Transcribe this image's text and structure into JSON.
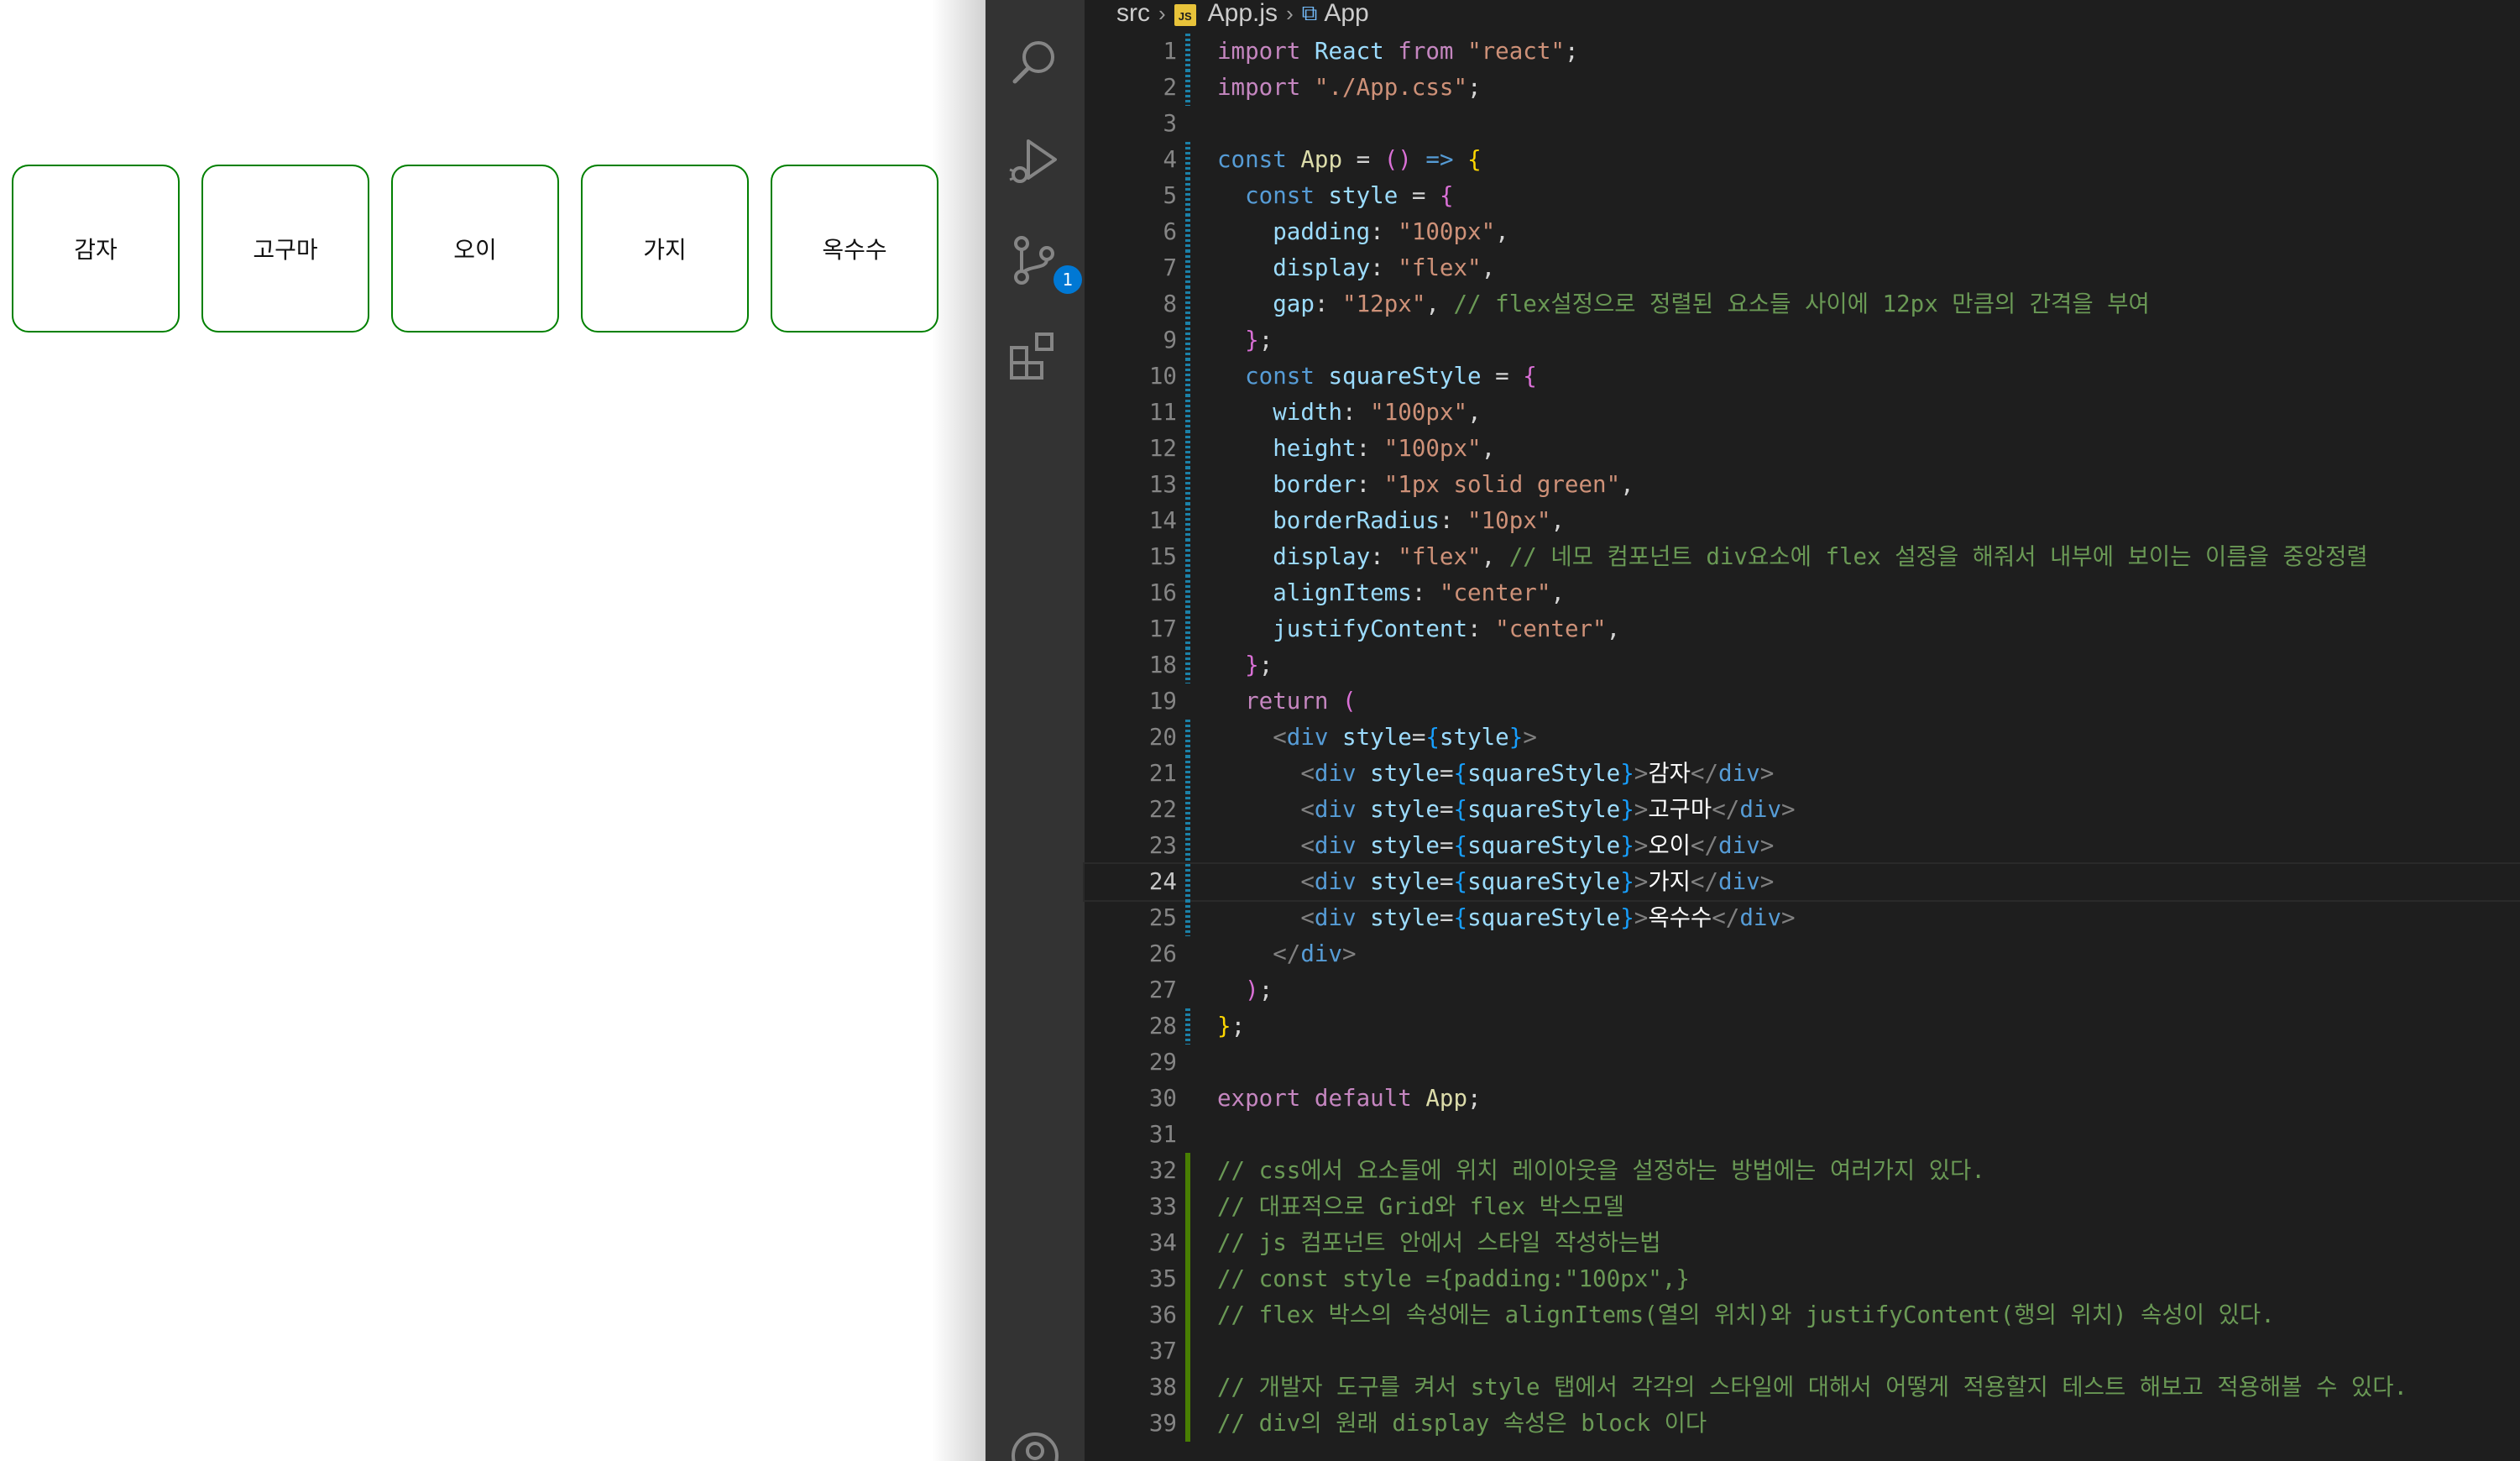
{
  "preview": {
    "items": [
      "감자",
      "고구마",
      "오이",
      "가지",
      "옥수수"
    ]
  },
  "activity_bar": {
    "icons": [
      "search-icon",
      "run-debug-icon",
      "source-control-icon",
      "extensions-icon",
      "account-icon"
    ],
    "scm_badge": "1"
  },
  "breadcrumb": {
    "folder": "src",
    "file": "App.js",
    "file_badge": "JS",
    "symbol": "App"
  },
  "editor": {
    "current_line": 24,
    "lines": [
      {
        "n": "1",
        "gutter": "mod",
        "tokens": [
          [
            "kw",
            "import"
          ],
          [
            "plain",
            " "
          ],
          [
            "var",
            "React"
          ],
          [
            "plain",
            " "
          ],
          [
            "kw",
            "from"
          ],
          [
            "plain",
            " "
          ],
          [
            "str",
            "\"react\""
          ],
          [
            "plain",
            ";"
          ]
        ]
      },
      {
        "n": "2",
        "gutter": "mod",
        "tokens": [
          [
            "kw",
            "import"
          ],
          [
            "plain",
            " "
          ],
          [
            "str",
            "\"./App.css\""
          ],
          [
            "plain",
            ";"
          ]
        ]
      },
      {
        "n": "3",
        "gutter": "",
        "tokens": []
      },
      {
        "n": "4",
        "gutter": "mod",
        "tokens": [
          [
            "dec",
            "const"
          ],
          [
            "plain",
            " "
          ],
          [
            "fn",
            "App"
          ],
          [
            "plain",
            " = "
          ],
          [
            "p2",
            "()"
          ],
          [
            "plain",
            " "
          ],
          [
            "dec",
            "=>"
          ],
          [
            "plain",
            " "
          ],
          [
            "p1",
            "{"
          ]
        ]
      },
      {
        "n": "5",
        "gutter": "mod",
        "tokens": [
          [
            "plain",
            "  "
          ],
          [
            "dec",
            "const"
          ],
          [
            "plain",
            " "
          ],
          [
            "var",
            "style"
          ],
          [
            "plain",
            " = "
          ],
          [
            "p2",
            "{"
          ]
        ]
      },
      {
        "n": "6",
        "gutter": "mod",
        "tokens": [
          [
            "plain",
            "    "
          ],
          [
            "var",
            "padding"
          ],
          [
            "plain",
            ": "
          ],
          [
            "str",
            "\"100px\""
          ],
          [
            "plain",
            ","
          ]
        ]
      },
      {
        "n": "7",
        "gutter": "mod",
        "tokens": [
          [
            "plain",
            "    "
          ],
          [
            "var",
            "display"
          ],
          [
            "plain",
            ": "
          ],
          [
            "str",
            "\"flex\""
          ],
          [
            "plain",
            ","
          ]
        ]
      },
      {
        "n": "8",
        "gutter": "mod",
        "tokens": [
          [
            "plain",
            "    "
          ],
          [
            "var",
            "gap"
          ],
          [
            "plain",
            ": "
          ],
          [
            "str",
            "\"12px\""
          ],
          [
            "plain",
            ", "
          ],
          [
            "com",
            "// flex설정으로 정렬된 요소들 사이에 12px 만큼의 간격을 부여"
          ]
        ]
      },
      {
        "n": "9",
        "gutter": "mod",
        "tokens": [
          [
            "plain",
            "  "
          ],
          [
            "p2",
            "}"
          ],
          [
            "plain",
            ";"
          ]
        ]
      },
      {
        "n": "10",
        "gutter": "mod",
        "tokens": [
          [
            "plain",
            "  "
          ],
          [
            "dec",
            "const"
          ],
          [
            "plain",
            " "
          ],
          [
            "var",
            "squareStyle"
          ],
          [
            "plain",
            " = "
          ],
          [
            "p2",
            "{"
          ]
        ]
      },
      {
        "n": "11",
        "gutter": "mod",
        "tokens": [
          [
            "plain",
            "    "
          ],
          [
            "var",
            "width"
          ],
          [
            "plain",
            ": "
          ],
          [
            "str",
            "\"100px\""
          ],
          [
            "plain",
            ","
          ]
        ]
      },
      {
        "n": "12",
        "gutter": "mod",
        "tokens": [
          [
            "plain",
            "    "
          ],
          [
            "var",
            "height"
          ],
          [
            "plain",
            ": "
          ],
          [
            "str",
            "\"100px\""
          ],
          [
            "plain",
            ","
          ]
        ]
      },
      {
        "n": "13",
        "gutter": "mod",
        "tokens": [
          [
            "plain",
            "    "
          ],
          [
            "var",
            "border"
          ],
          [
            "plain",
            ": "
          ],
          [
            "str",
            "\"1px solid green\""
          ],
          [
            "plain",
            ","
          ]
        ]
      },
      {
        "n": "14",
        "gutter": "mod",
        "tokens": [
          [
            "plain",
            "    "
          ],
          [
            "var",
            "borderRadius"
          ],
          [
            "plain",
            ": "
          ],
          [
            "str",
            "\"10px\""
          ],
          [
            "plain",
            ","
          ]
        ]
      },
      {
        "n": "15",
        "gutter": "mod",
        "tokens": [
          [
            "plain",
            "    "
          ],
          [
            "var",
            "display"
          ],
          [
            "plain",
            ": "
          ],
          [
            "str",
            "\"flex\""
          ],
          [
            "plain",
            ", "
          ],
          [
            "com",
            "// 네모 컴포넌트 div요소에 flex 설정을 해줘서 내부에 보이는 이름을 중앙정렬"
          ]
        ]
      },
      {
        "n": "16",
        "gutter": "mod",
        "tokens": [
          [
            "plain",
            "    "
          ],
          [
            "var",
            "alignItems"
          ],
          [
            "plain",
            ": "
          ],
          [
            "str",
            "\"center\""
          ],
          [
            "plain",
            ","
          ]
        ]
      },
      {
        "n": "17",
        "gutter": "mod",
        "tokens": [
          [
            "plain",
            "    "
          ],
          [
            "var",
            "justifyContent"
          ],
          [
            "plain",
            ": "
          ],
          [
            "str",
            "\"center\""
          ],
          [
            "plain",
            ","
          ]
        ]
      },
      {
        "n": "18",
        "gutter": "mod",
        "tokens": [
          [
            "plain",
            "  "
          ],
          [
            "p2",
            "}"
          ],
          [
            "plain",
            ";"
          ]
        ]
      },
      {
        "n": "19",
        "gutter": "",
        "tokens": [
          [
            "plain",
            "  "
          ],
          [
            "kw",
            "return"
          ],
          [
            "plain",
            " "
          ],
          [
            "p2",
            "("
          ]
        ]
      },
      {
        "n": "20",
        "gutter": "mod",
        "tokens": [
          [
            "plain",
            "    "
          ],
          [
            "ang",
            "<"
          ],
          [
            "tag",
            "div"
          ],
          [
            "plain",
            " "
          ],
          [
            "var",
            "style"
          ],
          [
            "plain",
            "="
          ],
          [
            "p3",
            "{"
          ],
          [
            "var",
            "style"
          ],
          [
            "p3",
            "}"
          ],
          [
            "ang",
            ">"
          ]
        ]
      },
      {
        "n": "21",
        "gutter": "mod",
        "tokens": [
          [
            "plain",
            "      "
          ],
          [
            "ang",
            "<"
          ],
          [
            "tag",
            "div"
          ],
          [
            "plain",
            " "
          ],
          [
            "var",
            "style"
          ],
          [
            "plain",
            "="
          ],
          [
            "p3",
            "{"
          ],
          [
            "var",
            "squareStyle"
          ],
          [
            "p3",
            "}"
          ],
          [
            "ang",
            ">"
          ],
          [
            "txt",
            "감자"
          ],
          [
            "ang",
            "</"
          ],
          [
            "tag",
            "div"
          ],
          [
            "ang",
            ">"
          ]
        ]
      },
      {
        "n": "22",
        "gutter": "mod",
        "tokens": [
          [
            "plain",
            "      "
          ],
          [
            "ang",
            "<"
          ],
          [
            "tag",
            "div"
          ],
          [
            "plain",
            " "
          ],
          [
            "var",
            "style"
          ],
          [
            "plain",
            "="
          ],
          [
            "p3",
            "{"
          ],
          [
            "var",
            "squareStyle"
          ],
          [
            "p3",
            "}"
          ],
          [
            "ang",
            ">"
          ],
          [
            "txt",
            "고구마"
          ],
          [
            "ang",
            "</"
          ],
          [
            "tag",
            "div"
          ],
          [
            "ang",
            ">"
          ]
        ]
      },
      {
        "n": "23",
        "gutter": "mod",
        "tokens": [
          [
            "plain",
            "      "
          ],
          [
            "ang",
            "<"
          ],
          [
            "tag",
            "div"
          ],
          [
            "plain",
            " "
          ],
          [
            "var",
            "style"
          ],
          [
            "plain",
            "="
          ],
          [
            "p3",
            "{"
          ],
          [
            "var",
            "squareStyle"
          ],
          [
            "p3",
            "}"
          ],
          [
            "ang",
            ">"
          ],
          [
            "txt",
            "오이"
          ],
          [
            "ang",
            "</"
          ],
          [
            "tag",
            "div"
          ],
          [
            "ang",
            ">"
          ]
        ]
      },
      {
        "n": "24",
        "gutter": "mod",
        "tokens": [
          [
            "plain",
            "      "
          ],
          [
            "ang",
            "<"
          ],
          [
            "tag",
            "div"
          ],
          [
            "plain",
            " "
          ],
          [
            "var",
            "style"
          ],
          [
            "plain",
            "="
          ],
          [
            "p3",
            "{"
          ],
          [
            "var",
            "squareStyle"
          ],
          [
            "p3",
            "}"
          ],
          [
            "ang",
            ">"
          ],
          [
            "txt",
            "가지"
          ],
          [
            "ang",
            "</"
          ],
          [
            "tag",
            "div"
          ],
          [
            "ang",
            ">"
          ]
        ]
      },
      {
        "n": "25",
        "gutter": "mod",
        "tokens": [
          [
            "plain",
            "      "
          ],
          [
            "ang",
            "<"
          ],
          [
            "tag",
            "div"
          ],
          [
            "plain",
            " "
          ],
          [
            "var",
            "style"
          ],
          [
            "plain",
            "="
          ],
          [
            "p3",
            "{"
          ],
          [
            "var",
            "squareStyle"
          ],
          [
            "p3",
            "}"
          ],
          [
            "ang",
            ">"
          ],
          [
            "txt",
            "옥수수"
          ],
          [
            "ang",
            "</"
          ],
          [
            "tag",
            "div"
          ],
          [
            "ang",
            ">"
          ]
        ]
      },
      {
        "n": "26",
        "gutter": "",
        "tokens": [
          [
            "plain",
            "    "
          ],
          [
            "ang",
            "</"
          ],
          [
            "tag",
            "div"
          ],
          [
            "ang",
            ">"
          ]
        ]
      },
      {
        "n": "27",
        "gutter": "",
        "tokens": [
          [
            "plain",
            "  "
          ],
          [
            "p2",
            ")"
          ],
          [
            "plain",
            ";"
          ]
        ]
      },
      {
        "n": "28",
        "gutter": "mod",
        "tokens": [
          [
            "p1",
            "}"
          ],
          [
            "plain",
            ";"
          ]
        ]
      },
      {
        "n": "29",
        "gutter": "",
        "tokens": []
      },
      {
        "n": "30",
        "gutter": "",
        "tokens": [
          [
            "kw",
            "export"
          ],
          [
            "plain",
            " "
          ],
          [
            "kw",
            "default"
          ],
          [
            "plain",
            " "
          ],
          [
            "fn",
            "App"
          ],
          [
            "plain",
            ";"
          ]
        ]
      },
      {
        "n": "31",
        "gutter": "",
        "tokens": []
      },
      {
        "n": "32",
        "gutter": "add",
        "tokens": [
          [
            "com",
            "// css에서 요소들에 위치 레이아웃을 설정하는 방법에는 여러가지 있다."
          ]
        ]
      },
      {
        "n": "33",
        "gutter": "add",
        "tokens": [
          [
            "com",
            "// 대표적으로 Grid와 flex 박스모델"
          ]
        ]
      },
      {
        "n": "34",
        "gutter": "add",
        "tokens": [
          [
            "com",
            "// js 컴포넌트 안에서 스타일 작성하는법"
          ]
        ]
      },
      {
        "n": "35",
        "gutter": "add",
        "tokens": [
          [
            "com",
            "// const style ={padding:\"100px\",}"
          ]
        ]
      },
      {
        "n": "36",
        "gutter": "add",
        "tokens": [
          [
            "com",
            "// flex 박스의 속성에는 alignItems(열의 위치)와 justifyContent(행의 위치) 속성이 있다."
          ]
        ]
      },
      {
        "n": "37",
        "gutter": "add",
        "tokens": []
      },
      {
        "n": "38",
        "gutter": "add",
        "tokens": [
          [
            "com",
            "// 개발자 도구를 켜서 style 탭에서 각각의 스타일에 대해서 어떻게 적용할지 테스트 해보고 적용해볼 수 있다."
          ]
        ]
      },
      {
        "n": "39",
        "gutter": "add",
        "tokens": [
          [
            "com",
            "// div의 원래 display 속성은 block 이다"
          ]
        ]
      }
    ]
  }
}
